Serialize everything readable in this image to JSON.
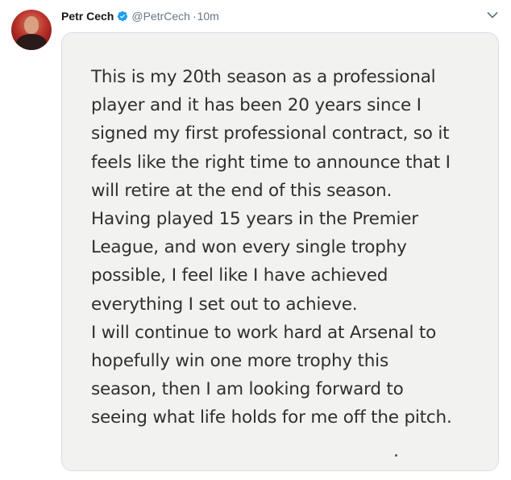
{
  "tweet": {
    "author_name": "Petr Cech",
    "handle": "@PetrCech",
    "separator": "·",
    "time": "10m",
    "statement_lines": [
      "This is my 20th season as a professional",
      "player and it has been 20 years since I",
      "signed my first professional contract, so it",
      "feels like the right time to announce that I",
      "will retire at the end of this season.",
      "Having played 15 years in the Premier",
      "League, and won every single trophy",
      "possible, I feel like I have achieved",
      "everything I set out to achieve.",
      "I will continue to work hard at Arsenal to",
      "hopefully win one more trophy this",
      "season, then I am looking forward to",
      "seeing what life holds for me off the pitch."
    ]
  },
  "icons": {
    "verified": "verified-badge-icon",
    "menu": "chevron-down-icon"
  },
  "colors": {
    "name": "#14171a",
    "secondary": "#657786",
    "verified": "#1da1f2",
    "card_background": "#f2f2f1",
    "statement_text": "#2f2f2f"
  }
}
